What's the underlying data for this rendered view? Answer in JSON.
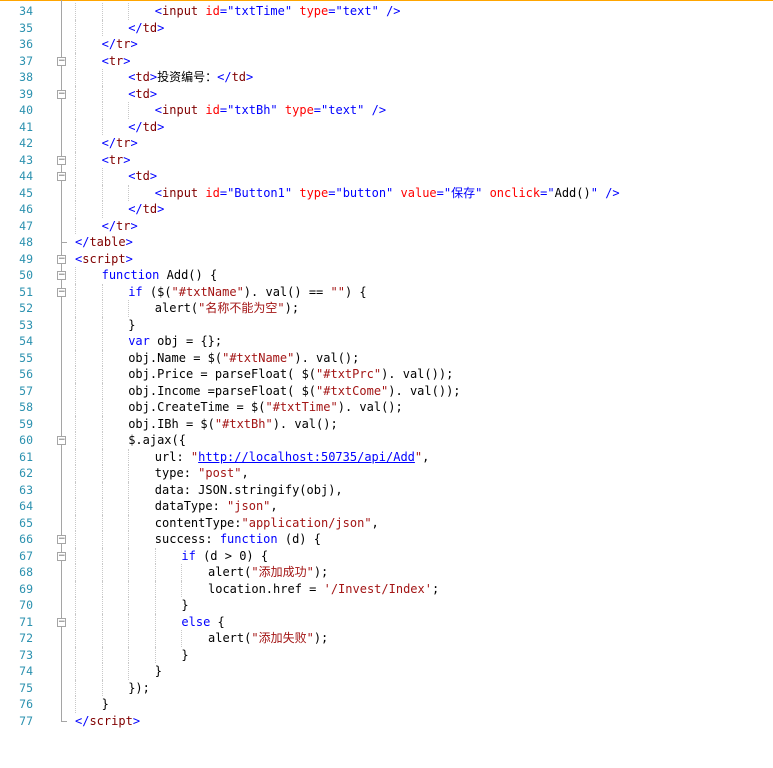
{
  "editor": {
    "lines": [
      {
        "n": "34",
        "indent": 6,
        "tokens": [
          [
            "punc",
            "<"
          ],
          [
            "tag",
            "input"
          ],
          [
            "plain",
            " "
          ],
          [
            "attr",
            "id"
          ],
          [
            "punc",
            "="
          ],
          [
            "str",
            "\"txtTime\""
          ],
          [
            "plain",
            " "
          ],
          [
            "attr",
            "type"
          ],
          [
            "punc",
            "="
          ],
          [
            "str",
            "\"text\""
          ],
          [
            "plain",
            " "
          ],
          [
            "punc",
            "/>"
          ]
        ]
      },
      {
        "n": "35",
        "indent": 4,
        "tokens": [
          [
            "punc",
            "</"
          ],
          [
            "tag",
            "td"
          ],
          [
            "punc",
            ">"
          ]
        ]
      },
      {
        "n": "36",
        "indent": 2,
        "tokens": [
          [
            "punc",
            "</"
          ],
          [
            "tag",
            "tr"
          ],
          [
            "punc",
            ">"
          ]
        ]
      },
      {
        "n": "37",
        "indent": 2,
        "tokens": [
          [
            "punc",
            "<"
          ],
          [
            "tag",
            "tr"
          ],
          [
            "punc",
            ">"
          ]
        ]
      },
      {
        "n": "38",
        "indent": 4,
        "tokens": [
          [
            "punc",
            "<"
          ],
          [
            "tag",
            "td"
          ],
          [
            "punc",
            ">"
          ],
          [
            "plain",
            "投资编号："
          ],
          [
            "punc",
            "</"
          ],
          [
            "tag",
            "td"
          ],
          [
            "punc",
            ">"
          ]
        ]
      },
      {
        "n": "39",
        "indent": 4,
        "tokens": [
          [
            "punc",
            "<"
          ],
          [
            "tag",
            "td"
          ],
          [
            "punc",
            ">"
          ]
        ]
      },
      {
        "n": "40",
        "indent": 6,
        "tokens": [
          [
            "punc",
            "<"
          ],
          [
            "tag",
            "input"
          ],
          [
            "plain",
            " "
          ],
          [
            "attr",
            "id"
          ],
          [
            "punc",
            "="
          ],
          [
            "str",
            "\"txtBh\""
          ],
          [
            "plain",
            " "
          ],
          [
            "attr",
            "type"
          ],
          [
            "punc",
            "="
          ],
          [
            "str",
            "\"text\""
          ],
          [
            "plain",
            " "
          ],
          [
            "punc",
            "/>"
          ]
        ]
      },
      {
        "n": "41",
        "indent": 4,
        "tokens": [
          [
            "punc",
            "</"
          ],
          [
            "tag",
            "td"
          ],
          [
            "punc",
            ">"
          ]
        ]
      },
      {
        "n": "42",
        "indent": 2,
        "tokens": [
          [
            "punc",
            "</"
          ],
          [
            "tag",
            "tr"
          ],
          [
            "punc",
            ">"
          ]
        ]
      },
      {
        "n": "43",
        "indent": 2,
        "tokens": [
          [
            "punc",
            "<"
          ],
          [
            "tag",
            "tr"
          ],
          [
            "punc",
            ">"
          ]
        ]
      },
      {
        "n": "44",
        "indent": 4,
        "tokens": [
          [
            "punc",
            "<"
          ],
          [
            "tag",
            "td"
          ],
          [
            "punc",
            ">"
          ]
        ]
      },
      {
        "n": "45",
        "indent": 6,
        "tokens": [
          [
            "punc",
            "<"
          ],
          [
            "tag",
            "input"
          ],
          [
            "plain",
            " "
          ],
          [
            "attr",
            "id"
          ],
          [
            "punc",
            "="
          ],
          [
            "str",
            "\"Button1\""
          ],
          [
            "plain",
            " "
          ],
          [
            "attr",
            "type"
          ],
          [
            "punc",
            "="
          ],
          [
            "str",
            "\"button\""
          ],
          [
            "plain",
            " "
          ],
          [
            "attr",
            "value"
          ],
          [
            "punc",
            "="
          ],
          [
            "str",
            "\"保存\""
          ],
          [
            "plain",
            " "
          ],
          [
            "attr",
            "onclick"
          ],
          [
            "punc",
            "="
          ],
          [
            "str",
            "\""
          ],
          [
            "plain",
            "Add()"
          ],
          [
            "str",
            "\""
          ],
          [
            "plain",
            " "
          ],
          [
            "punc",
            "/>"
          ]
        ]
      },
      {
        "n": "46",
        "indent": 4,
        "tokens": [
          [
            "punc",
            "</"
          ],
          [
            "tag",
            "td"
          ],
          [
            "punc",
            ">"
          ]
        ]
      },
      {
        "n": "47",
        "indent": 2,
        "tokens": [
          [
            "punc",
            "</"
          ],
          [
            "tag",
            "tr"
          ],
          [
            "punc",
            ">"
          ]
        ]
      },
      {
        "n": "48",
        "indent": 0,
        "tokens": [
          [
            "punc",
            "</"
          ],
          [
            "tag",
            "table"
          ],
          [
            "punc",
            ">"
          ]
        ]
      },
      {
        "n": "49",
        "indent": 0,
        "tokens": [
          [
            "punc",
            "<"
          ],
          [
            "tag",
            "script"
          ],
          [
            "punc",
            ">"
          ]
        ]
      },
      {
        "n": "50",
        "indent": 2,
        "tokens": [
          [
            "kw",
            "function"
          ],
          [
            "plain",
            " Add() {"
          ]
        ]
      },
      {
        "n": "51",
        "indent": 4,
        "tokens": [
          [
            "kw",
            "if"
          ],
          [
            "plain",
            " ($("
          ],
          [
            "jstr",
            "\"#txtName\""
          ],
          [
            "plain",
            "). val() == "
          ],
          [
            "jstr",
            "\"\""
          ],
          [
            "plain",
            ") {"
          ]
        ]
      },
      {
        "n": "52",
        "indent": 6,
        "tokens": [
          [
            "plain",
            "alert("
          ],
          [
            "jstr",
            "\"名称不能为空\""
          ],
          [
            "plain",
            ");"
          ]
        ]
      },
      {
        "n": "53",
        "indent": 4,
        "tokens": [
          [
            "plain",
            "}"
          ]
        ]
      },
      {
        "n": "54",
        "indent": 4,
        "tokens": [
          [
            "kw",
            "var"
          ],
          [
            "plain",
            " obj = {};"
          ]
        ]
      },
      {
        "n": "55",
        "indent": 4,
        "tokens": [
          [
            "plain",
            "obj.Name = $("
          ],
          [
            "jstr",
            "\"#txtName\""
          ],
          [
            "plain",
            "). val();"
          ]
        ]
      },
      {
        "n": "56",
        "indent": 4,
        "tokens": [
          [
            "plain",
            "obj.Price = parseFloat( $("
          ],
          [
            "jstr",
            "\"#txtPrc\""
          ],
          [
            "plain",
            "). val());"
          ]
        ]
      },
      {
        "n": "57",
        "indent": 4,
        "tokens": [
          [
            "plain",
            "obj.Income =parseFloat( $("
          ],
          [
            "jstr",
            "\"#txtCome\""
          ],
          [
            "plain",
            "). val());"
          ]
        ]
      },
      {
        "n": "58",
        "indent": 4,
        "tokens": [
          [
            "plain",
            "obj.CreateTime = $("
          ],
          [
            "jstr",
            "\"#txtTime\""
          ],
          [
            "plain",
            "). val();"
          ]
        ]
      },
      {
        "n": "59",
        "indent": 4,
        "tokens": [
          [
            "plain",
            "obj.IBh = $("
          ],
          [
            "jstr",
            "\"#txtBh\""
          ],
          [
            "plain",
            "). val();"
          ]
        ]
      },
      {
        "n": "60",
        "indent": 4,
        "tokens": [
          [
            "plain",
            "$.ajax({"
          ]
        ]
      },
      {
        "n": "61",
        "indent": 6,
        "tokens": [
          [
            "plain",
            "url: "
          ],
          [
            "jstr",
            "\""
          ],
          [
            "link",
            "http://localhost:50735/api/Add"
          ],
          [
            "jstr",
            "\""
          ],
          [
            "plain",
            ","
          ]
        ]
      },
      {
        "n": "62",
        "indent": 6,
        "tokens": [
          [
            "plain",
            "type: "
          ],
          [
            "jstr",
            "\"post\""
          ],
          [
            "plain",
            ","
          ]
        ]
      },
      {
        "n": "63",
        "indent": 6,
        "tokens": [
          [
            "plain",
            "data: JSON.stringify(obj),"
          ]
        ]
      },
      {
        "n": "64",
        "indent": 6,
        "tokens": [
          [
            "plain",
            "dataType: "
          ],
          [
            "jstr",
            "\"json\""
          ],
          [
            "plain",
            ","
          ]
        ]
      },
      {
        "n": "65",
        "indent": 6,
        "tokens": [
          [
            "plain",
            "contentType:"
          ],
          [
            "jstr",
            "\"application/json\""
          ],
          [
            "plain",
            ","
          ]
        ]
      },
      {
        "n": "66",
        "indent": 6,
        "tokens": [
          [
            "plain",
            "success: "
          ],
          [
            "kw",
            "function"
          ],
          [
            "plain",
            " (d) {"
          ]
        ]
      },
      {
        "n": "67",
        "indent": 8,
        "tokens": [
          [
            "kw",
            "if"
          ],
          [
            "plain",
            " (d > 0) {"
          ]
        ]
      },
      {
        "n": "68",
        "indent": 10,
        "tokens": [
          [
            "plain",
            "alert("
          ],
          [
            "jstr",
            "\"添加成功\""
          ],
          [
            "plain",
            ");"
          ]
        ]
      },
      {
        "n": "69",
        "indent": 10,
        "tokens": [
          [
            "plain",
            "location.href = "
          ],
          [
            "jstr",
            "'/Invest/Index'"
          ],
          [
            "plain",
            ";"
          ]
        ]
      },
      {
        "n": "70",
        "indent": 8,
        "tokens": [
          [
            "plain",
            "}"
          ]
        ]
      },
      {
        "n": "71",
        "indent": 8,
        "tokens": [
          [
            "kw",
            "else"
          ],
          [
            "plain",
            " {"
          ]
        ]
      },
      {
        "n": "72",
        "indent": 10,
        "tokens": [
          [
            "plain",
            "alert("
          ],
          [
            "jstr",
            "\"添加失败\""
          ],
          [
            "plain",
            ");"
          ]
        ]
      },
      {
        "n": "73",
        "indent": 8,
        "tokens": [
          [
            "plain",
            "}"
          ]
        ]
      },
      {
        "n": "74",
        "indent": 6,
        "tokens": [
          [
            "plain",
            "}"
          ]
        ]
      },
      {
        "n": "75",
        "indent": 4,
        "tokens": [
          [
            "plain",
            "});"
          ]
        ]
      },
      {
        "n": "76",
        "indent": 2,
        "tokens": [
          [
            "plain",
            "}"
          ]
        ]
      },
      {
        "n": "77",
        "indent": 0,
        "tokens": [
          [
            "punc",
            "</"
          ],
          [
            "tag",
            "script"
          ],
          [
            "punc",
            ">"
          ]
        ]
      }
    ],
    "fold_markers": [
      {
        "line": "37",
        "symbol": "−"
      },
      {
        "line": "39",
        "symbol": "−"
      },
      {
        "line": "43",
        "symbol": "−"
      },
      {
        "line": "44",
        "symbol": "−"
      },
      {
        "line": "49",
        "symbol": "−"
      },
      {
        "line": "50",
        "symbol": "−"
      },
      {
        "line": "51",
        "symbol": "−"
      },
      {
        "line": "60",
        "symbol": "−"
      },
      {
        "line": "66",
        "symbol": "−"
      },
      {
        "line": "67",
        "symbol": "−"
      },
      {
        "line": "71",
        "symbol": "−"
      }
    ],
    "colors": {
      "line_number": "#2b91af",
      "html_punct": "#0000ff",
      "html_tag": "#800000",
      "html_attr": "#ff0000",
      "keyword": "#0000ff",
      "js_string": "#a31515"
    }
  }
}
